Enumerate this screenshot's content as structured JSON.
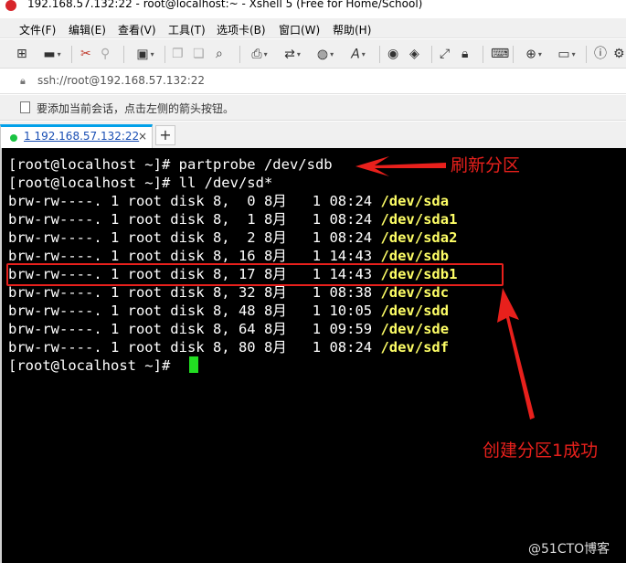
{
  "window": {
    "title": "192.168.57.132:22 - root@localhost:~ - Xshell 5 (Free for Home/School)"
  },
  "menu": {
    "items": [
      "文件(F)",
      "编辑(E)",
      "查看(V)",
      "工具(T)",
      "选项卡(B)",
      "窗口(W)",
      "帮助(H)"
    ]
  },
  "toolbar": {
    "icons": [
      "new-session-icon",
      "open-folder-icon",
      "disconnect-icon",
      "reconnect-icon",
      "properties-icon",
      "copy-icon",
      "paste-icon",
      "find-icon",
      "print-icon",
      "transfer-icon",
      "globe-icon",
      "font-icon",
      "xftp-icon",
      "xagent-icon",
      "fullscreen-icon",
      "lock-icon",
      "keyboard-icon",
      "compose-icon",
      "layout-icon",
      "help-icon",
      "settings-icon"
    ]
  },
  "address": {
    "url": "ssh://root@192.168.57.132:22"
  },
  "hint": {
    "text": "要添加当前会话，点击左侧的箭头按钮。"
  },
  "tabs": [
    {
      "label": "1 192.168.57.132:22",
      "close": "×",
      "status_color": "#19c342"
    }
  ],
  "new_tab_label": "+",
  "terminal": {
    "lines": [
      {
        "text": "[root@localhost ~]# partprobe /dev/sdb"
      },
      {
        "text": "[root@localhost ~]# ll /dev/sd*"
      },
      {
        "text": "brw-rw----. 1 root disk 8,  0 8月   1 08:24 ",
        "dev": "/dev/sda"
      },
      {
        "text": "brw-rw----. 1 root disk 8,  1 8月   1 08:24 ",
        "dev": "/dev/sda1"
      },
      {
        "text": "brw-rw----. 1 root disk 8,  2 8月   1 08:24 ",
        "dev": "/dev/sda2"
      },
      {
        "text": "brw-rw----. 1 root disk 8, 16 8月   1 14:43 ",
        "dev": "/dev/sdb"
      },
      {
        "text": "brw-rw----. 1 root disk 8, 17 8月   1 14:43 ",
        "dev": "/dev/sdb1"
      },
      {
        "text": "brw-rw----. 1 root disk 8, 32 8月   1 08:38 ",
        "dev": "/dev/sdc"
      },
      {
        "text": "brw-rw----. 1 root disk 8, 48 8月   1 10:05 ",
        "dev": "/dev/sdd"
      },
      {
        "text": "brw-rw----. 1 root disk 8, 64 8月   1 09:59 ",
        "dev": "/dev/sde"
      },
      {
        "text": "brw-rw----. 1 root disk 8, 80 8月   1 08:24 ",
        "dev": "/dev/sdf"
      },
      {
        "text": "[root@localhost ~]# "
      }
    ],
    "background": "#000000",
    "text_color": "#ffffff",
    "device_color": "#ffff66",
    "cursor_color": "#22dd22"
  },
  "annotations": {
    "refresh": "刷新分区",
    "created": "创建分区1成功",
    "color": "#e8201c"
  },
  "watermark": "@51CTO博客"
}
